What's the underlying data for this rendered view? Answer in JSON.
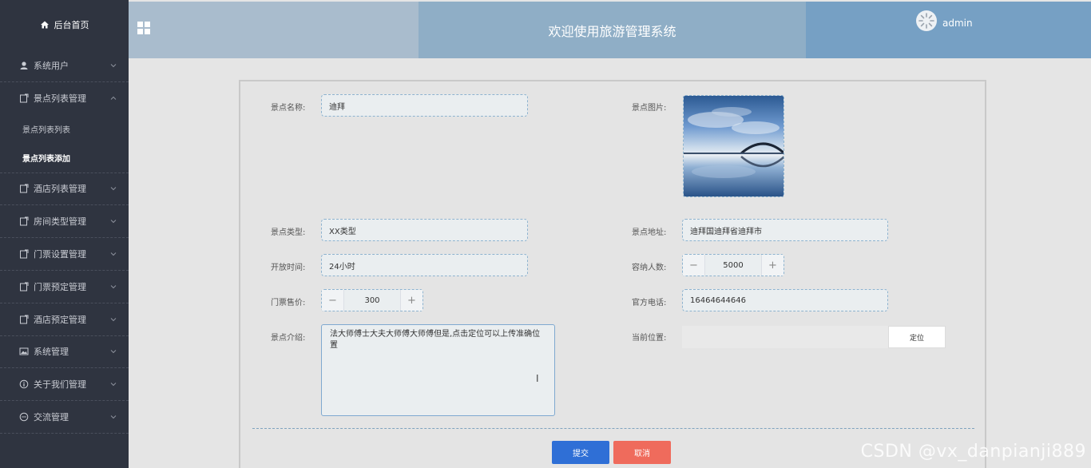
{
  "sidebar": {
    "home": "后台首页",
    "items": [
      {
        "label": "系统用户",
        "icon": "user-icon"
      },
      {
        "label": "景点列表管理",
        "icon": "document-icon",
        "expanded": true,
        "children": [
          {
            "label": "景点列表列表"
          },
          {
            "label": "景点列表添加",
            "active": true
          }
        ]
      },
      {
        "label": "酒店列表管理",
        "icon": "document-icon"
      },
      {
        "label": "房间类型管理",
        "icon": "document-icon"
      },
      {
        "label": "门票设置管理",
        "icon": "document-icon"
      },
      {
        "label": "门票预定管理",
        "icon": "document-icon"
      },
      {
        "label": "酒店预定管理",
        "icon": "document-icon"
      },
      {
        "label": "系统管理",
        "icon": "picture-icon"
      },
      {
        "label": "关于我们管理",
        "icon": "info-icon"
      },
      {
        "label": "交流管理",
        "icon": "chat-icon"
      }
    ]
  },
  "header": {
    "title": "欢迎使用旅游管理系统",
    "username": "admin"
  },
  "form": {
    "name": {
      "label": "景点名称:",
      "value": "迪拜"
    },
    "image": {
      "label": "景点图片:"
    },
    "type": {
      "label": "景点类型:",
      "value": "XX类型"
    },
    "address": {
      "label": "景点地址:",
      "value": "迪拜国迪拜省迪拜市"
    },
    "hours": {
      "label": "开放时间:",
      "value": "24小时"
    },
    "capacity": {
      "label": "容纳人数:",
      "value": "5000"
    },
    "price": {
      "label": "门票售价:",
      "value": "300"
    },
    "phone": {
      "label": "官方电话:",
      "value": "16464644646"
    },
    "intro": {
      "label": "景点介绍:",
      "value": "法大师傅士大夫大师傅大师傅但是,点击定位可以上传准确位置"
    },
    "location": {
      "label": "当前位置:",
      "value": "",
      "button": "定位"
    },
    "minus": "−",
    "plus": "+",
    "submit": "提交",
    "cancel": "取消"
  },
  "watermark": "CSDN @vx_danpianji889",
  "colors": {
    "sidebar_bg": "#2f3440",
    "submit": "#2f6fd6",
    "cancel": "#ef6b5c"
  }
}
